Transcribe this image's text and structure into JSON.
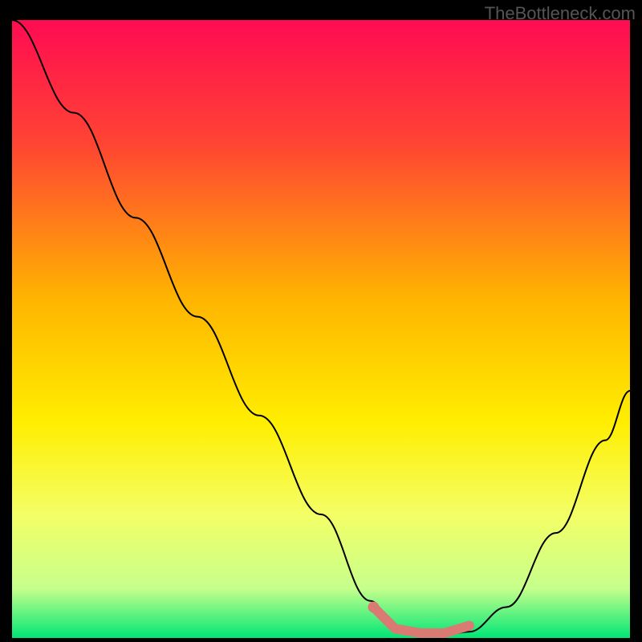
{
  "watermark": "TheBottleneck.com",
  "chart_data": {
    "type": "line",
    "title": "",
    "xlabel": "",
    "ylabel": "",
    "xlim": [
      0,
      100
    ],
    "ylim": [
      0,
      100
    ],
    "gradient_stops": [
      {
        "offset": 0,
        "color": "#ff0b52"
      },
      {
        "offset": 20,
        "color": "#ff4433"
      },
      {
        "offset": 45,
        "color": "#ffb400"
      },
      {
        "offset": 65,
        "color": "#ffee00"
      },
      {
        "offset": 80,
        "color": "#f4ff66"
      },
      {
        "offset": 92,
        "color": "#c6ff8c"
      },
      {
        "offset": 100,
        "color": "#00e676"
      }
    ],
    "series": [
      {
        "name": "bottleneck-curve",
        "x": [
          0,
          10,
          20,
          30,
          40,
          50,
          58,
          62,
          66,
          70,
          74,
          80,
          88,
          96,
          100
        ],
        "y": [
          100,
          85,
          68,
          52,
          36,
          20,
          6,
          2,
          0.5,
          0.5,
          1,
          5,
          17,
          32,
          40
        ]
      }
    ],
    "highlight_band": {
      "name": "optimal-range",
      "color": "#d97b72",
      "x_points": [
        58.5,
        62,
        66,
        70,
        74
      ],
      "y_points": [
        5,
        1.5,
        0.8,
        0.8,
        2
      ],
      "endpoint": {
        "x": 58.5,
        "y": 5
      }
    }
  }
}
